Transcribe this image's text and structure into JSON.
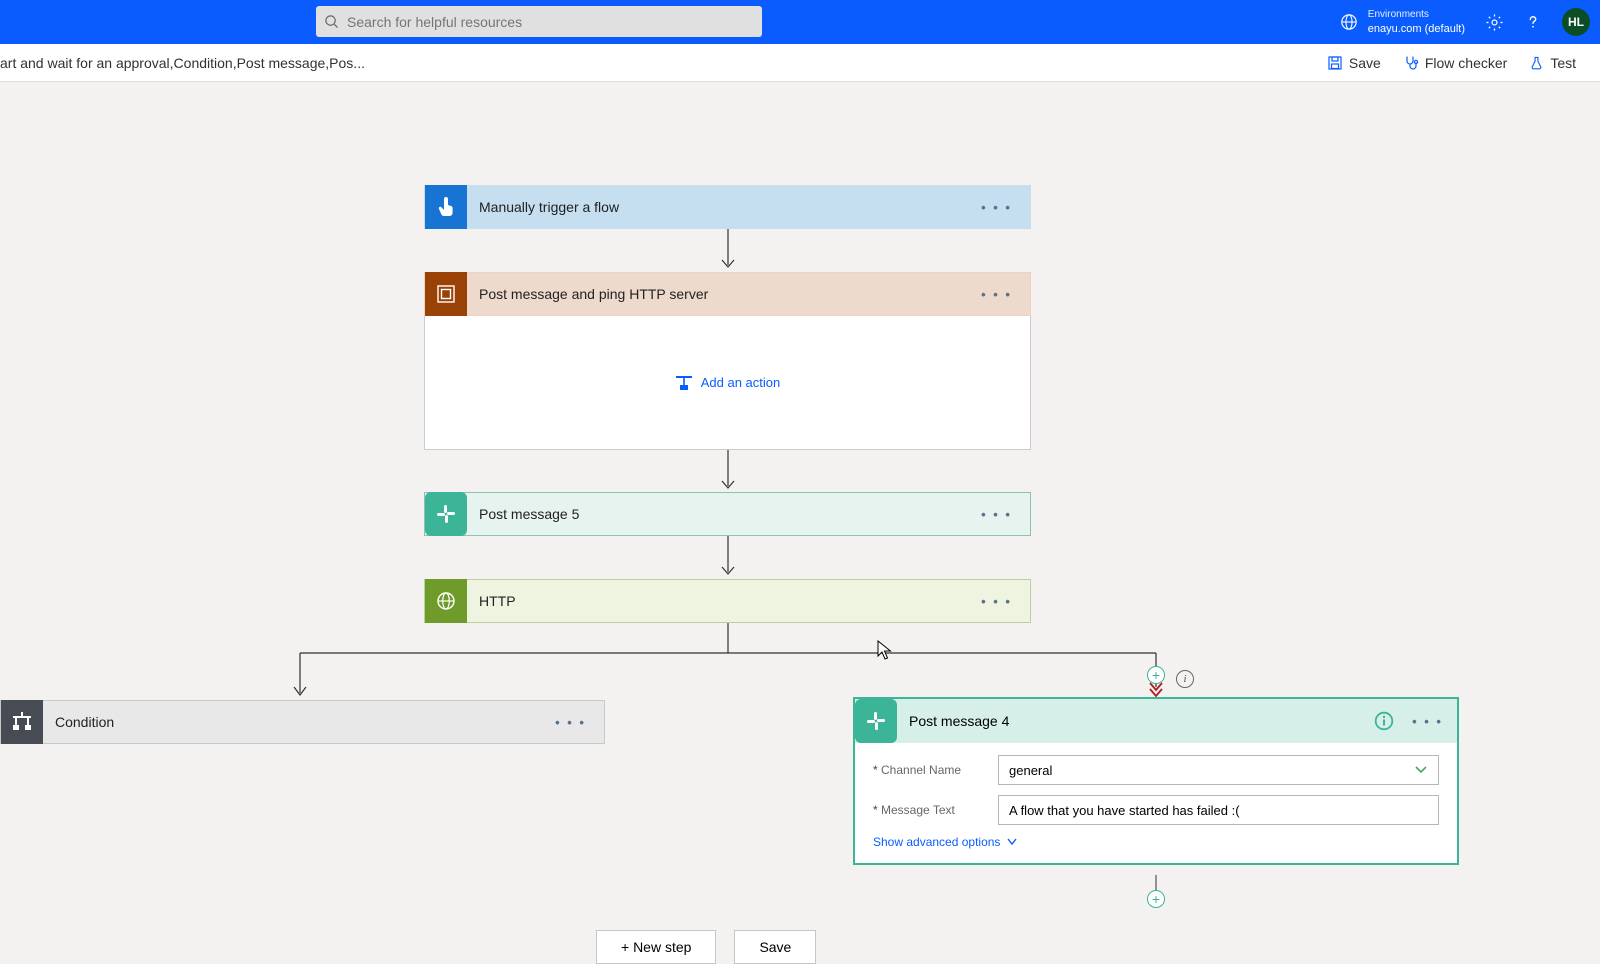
{
  "header": {
    "search_placeholder": "Search for helpful resources",
    "env_label": "Environments",
    "env_value": "enayu.com (default)",
    "avatar_initials": "HL"
  },
  "subheader": {
    "breadcrumb": "art and wait for an approval,Condition,Post message,Pos...",
    "save_label": "Save",
    "flow_checker_label": "Flow checker",
    "test_label": "Test"
  },
  "flow": {
    "trigger_label": "Manually trigger a flow",
    "scope_label": "Post message and ping HTTP server",
    "add_action_label": "Add an action",
    "post5_label": "Post message 5",
    "http_label": "HTTP",
    "condition_label": "Condition",
    "pm4": {
      "title": "Post message 4",
      "channel_label": "Channel Name",
      "channel_value": "general",
      "message_label": "Message Text",
      "message_value": "A flow that you have started has failed :(",
      "advanced_label": "Show advanced options"
    }
  },
  "buttons": {
    "new_step": "+ New step",
    "save": "Save"
  },
  "more": "• • •"
}
